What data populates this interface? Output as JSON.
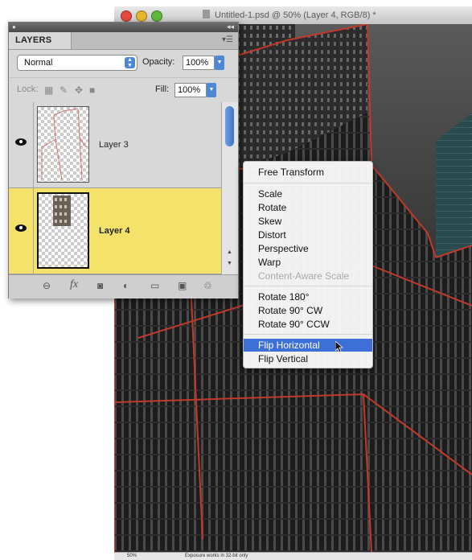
{
  "document_window": {
    "title": "Untitled-1.psd @ 50% (Layer 4, RGB/8) *",
    "status": {
      "zoom": "50%",
      "info": "Exposure works in 32-bit only"
    }
  },
  "layers_panel": {
    "tab_label": "LAYERS",
    "blend_mode": "Normal",
    "opacity_label": "Opacity:",
    "opacity_value": "100%",
    "lock_label": "Lock:",
    "fill_label": "Fill:",
    "fill_value": "100%",
    "layers": [
      {
        "name": "Layer 3",
        "selected": false,
        "visible": true
      },
      {
        "name": "Layer 4",
        "selected": true,
        "visible": true
      }
    ],
    "bottom_icons": [
      "link-icon",
      "fx-icon",
      "mask-icon",
      "adjustment-icon",
      "folder-icon",
      "new-layer-icon",
      "trash-icon"
    ],
    "bottom_fx_glyph": "fx"
  },
  "context_menu": {
    "groups": [
      [
        "Free Transform"
      ],
      [
        "Scale",
        "Rotate",
        "Skew",
        "Distort",
        "Perspective",
        "Warp",
        "Content-Aware Scale"
      ],
      [
        "Rotate 180°",
        "Rotate 90° CW",
        "Rotate 90° CCW"
      ],
      [
        "Flip Horizontal",
        "Flip Vertical"
      ]
    ],
    "disabled_item": "Content-Aware Scale",
    "highlighted_item": "Flip Horizontal"
  },
  "colors": {
    "selected_layer": "#f5e26a",
    "menu_highlight": "#3d6fd6",
    "guide_lines": "#c0392b"
  }
}
